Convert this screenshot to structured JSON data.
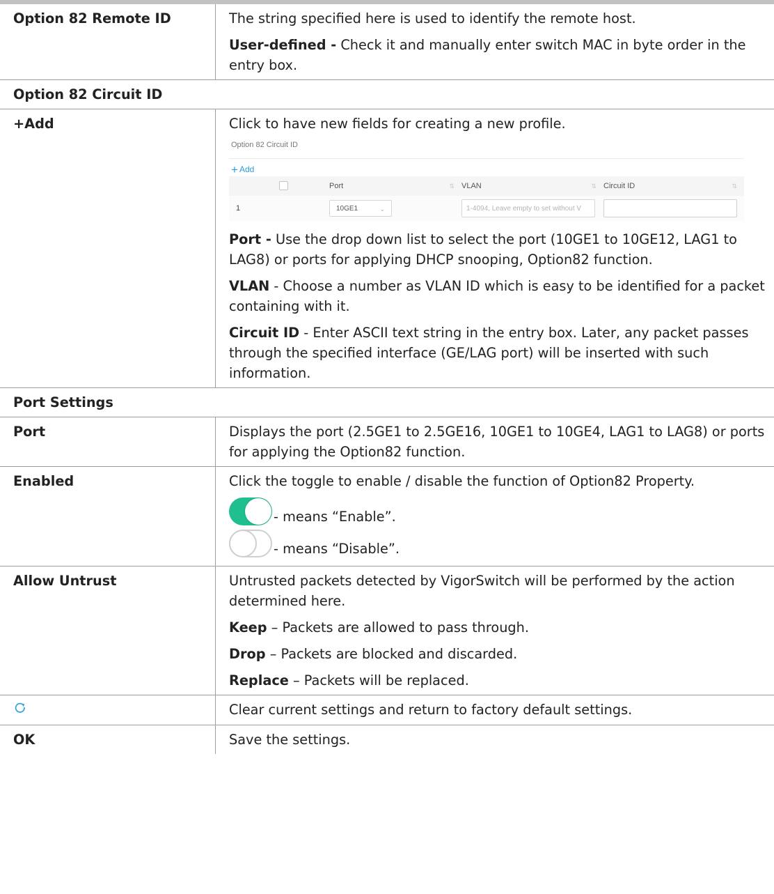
{
  "rows": {
    "remote_id": {
      "label": "Option 82 Remote ID",
      "text": "The string specified here is used to identify the remote host.",
      "user_defined_term": "User-defined -",
      "user_defined_text": " Check it and manually enter switch MAC in byte order in the entry box."
    },
    "circuit_section": {
      "label": "Option 82 Circuit ID"
    },
    "add": {
      "label": "+Add",
      "text": "Click to have new fields for creating a new profile.",
      "port_term": "Port -",
      "port_text": " Use the drop down list to select the port (10GE1 to 10GE12, LAG1 to LAG8) or ports for applying DHCP snooping, Option82 function.",
      "vlan_term": "VLAN",
      "vlan_text": " - Choose a number as VLAN ID which is easy to be identified for a packet containing with it.",
      "cid_term": "Circuit ID",
      "cid_text": " - Enter ASCII text string in the entry box. Later, any packet passes through the specified interface (GE/LAG port) will be inserted with such information."
    },
    "port_section": {
      "label": "Port Settings"
    },
    "port": {
      "label": "Port",
      "text": "Displays the port (2.5GE1 to 2.5GE16, 10GE1 to 10GE4, LAG1 to LAG8) or ports for applying the Option82 function."
    },
    "enabled": {
      "label": "Enabled",
      "text": "Click the toggle to enable / disable the function of Option82 Property.",
      "on_text": "- means “Enable”.",
      "off_text": "- means “Disable”."
    },
    "allow_untrust": {
      "label": "Allow Untrust",
      "text": "Untrusted packets detected by VigorSwitch will be performed by the action determined here.",
      "keep_term": "Keep",
      "keep_text": " – Packets are allowed to pass through.",
      "drop_term": "Drop",
      "drop_text": " – Packets are blocked and discarded.",
      "replace_term": "Replace",
      "replace_text": " – Packets will be replaced."
    },
    "reset": {
      "icon": "refresh-icon",
      "text": "Clear current settings and return to factory default settings."
    },
    "ok": {
      "label": "OK",
      "text": "Save the settings."
    }
  },
  "screenshot": {
    "title": "Option 82 Circuit ID",
    "add_label": "Add",
    "columns": {
      "port": "Port",
      "vlan": "VLAN",
      "circuit_id": "Circuit ID"
    },
    "row": {
      "index": "1",
      "port_value": "10GE1",
      "vlan_placeholder": "1-4094, Leave empty to set without V",
      "circuit_value": ""
    }
  },
  "colors": {
    "accent_toggle": "#1fbf8f",
    "link_blue": "#2a9fd8",
    "rule_gray": "#9e9e9e"
  }
}
